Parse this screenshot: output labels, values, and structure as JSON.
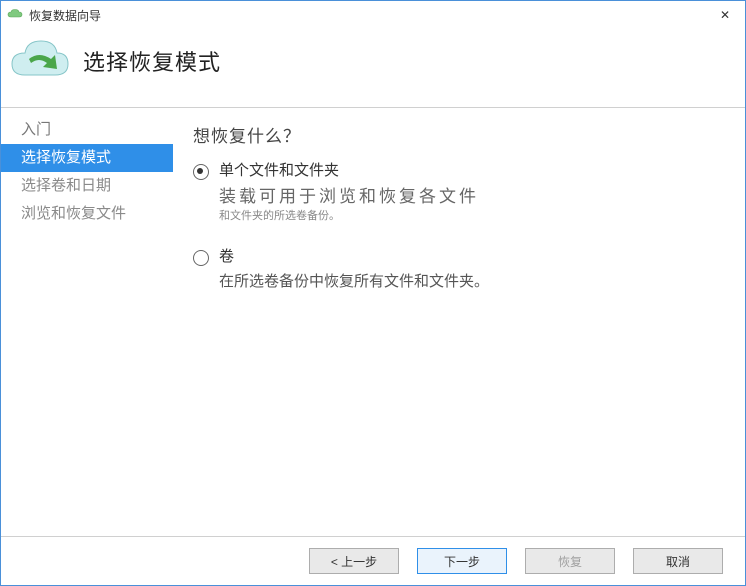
{
  "titlebar": {
    "title": "恢复数据向导",
    "close_glyph": "✕"
  },
  "header": {
    "heading": "选择恢复模式"
  },
  "sidebar": {
    "items": [
      {
        "label": "入门"
      },
      {
        "label": "选择恢复模式"
      },
      {
        "label": "选择卷和日期"
      },
      {
        "label": "浏览和恢复文件"
      }
    ],
    "active_index": 1
  },
  "content": {
    "question": "想恢复什么？",
    "options": [
      {
        "title": "单个文件和文件夹",
        "desc": "装载可用于浏览和恢复各文件",
        "fine": "和文件夹的所选卷备份。",
        "checked": true
      },
      {
        "title": "卷",
        "desc": "在所选卷备份中恢复所有文件和文件夹。",
        "checked": false
      }
    ]
  },
  "footer": {
    "back": "< 上一步",
    "next": "下一步",
    "recover": "恢复",
    "cancel": "取消"
  }
}
